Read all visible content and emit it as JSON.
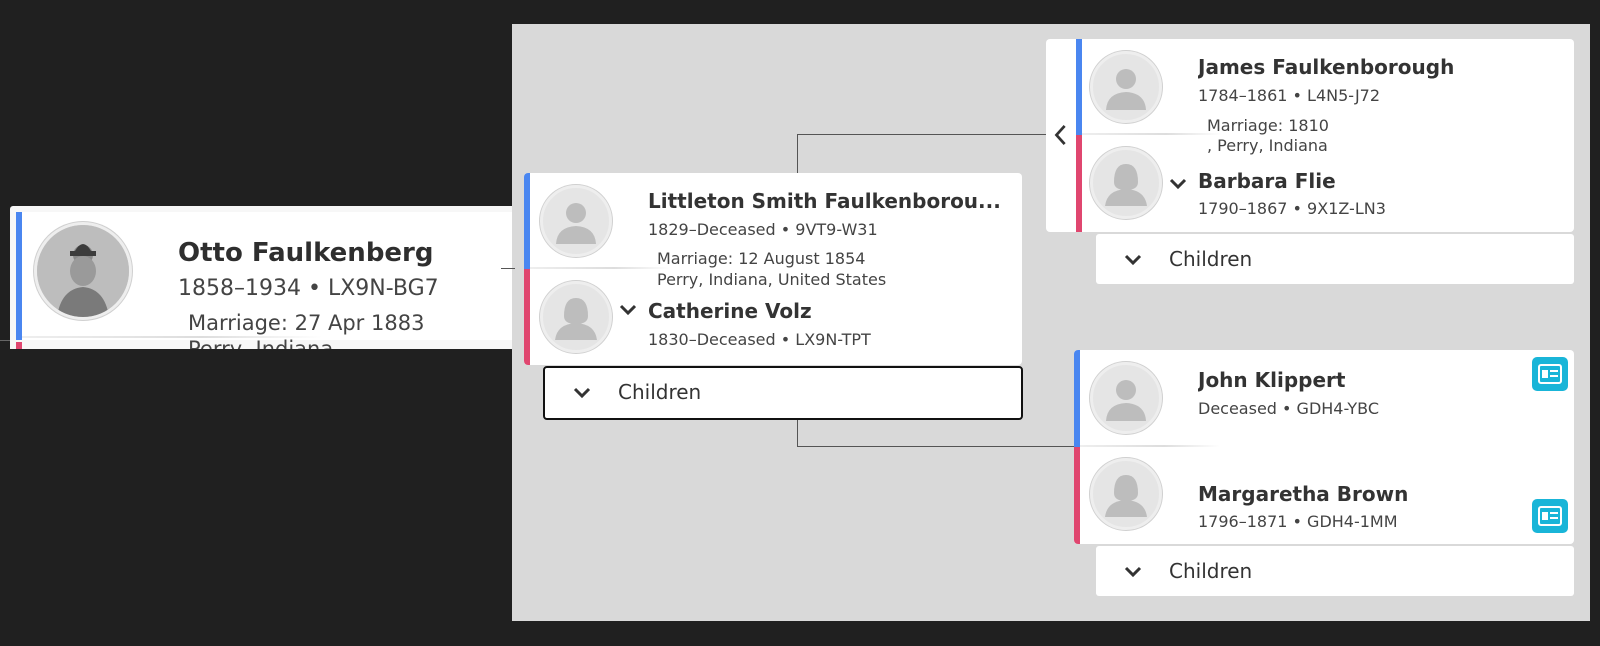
{
  "focus_person": {
    "name": "Otto Faulkenberg",
    "life": "1858–1934 • LX9N-BG7",
    "marriage": "Marriage: 27 Apr 1883",
    "marriage_place": "Perry, Indiana"
  },
  "parents": {
    "father": {
      "name": "Littleton Smith Faulkenborou...",
      "life": "1829–Deceased • 9VT9-W31"
    },
    "marriage": "Marriage: 12 August 1854",
    "marriage_place": "Perry, Indiana, United States",
    "mother": {
      "name": "Catherine Volz",
      "life": "1830–Deceased • LX9N-TPT"
    },
    "children_label": "Children"
  },
  "paternal_grandparents": {
    "father": {
      "name": "James Faulkenborough",
      "life": "1784–1861 • L4N5-J72"
    },
    "marriage": "Marriage: 1810",
    "marriage_place": ", Perry, Indiana",
    "mother": {
      "name": "Barbara Flie",
      "life": "1790–1867 • 9X1Z-LN3"
    },
    "children_label": "Children"
  },
  "maternal_grandparents": {
    "father": {
      "name": "John Klippert",
      "life": "Deceased • GDH4-YBC"
    },
    "mother": {
      "name": "Margaretha Brown",
      "life": "1796–1871 • GDH4-1MM"
    },
    "children_label": "Children"
  },
  "icons": {
    "avatar_placeholder": "person-silhouette-icon",
    "expand": "chevron-down-icon",
    "navigate_back": "chevron-left-icon",
    "record_hint": "record-card-icon"
  },
  "colors": {
    "male": "#4a86f0",
    "female": "#e0466f",
    "record_hint": "#19b5d8",
    "panel_bg": "#d9d9d9",
    "page_bg": "#202020"
  }
}
